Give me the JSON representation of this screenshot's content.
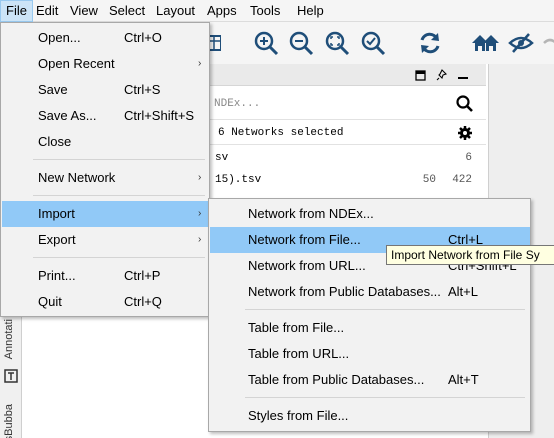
{
  "menubar": {
    "items": [
      "File",
      "Edit",
      "View",
      "Select",
      "Layout",
      "Apps",
      "Tools",
      "Help"
    ]
  },
  "file_menu": {
    "items": [
      {
        "label": "Open...",
        "shortcut": "Ctrl+O"
      },
      {
        "label": "Open Recent",
        "shortcut": ""
      },
      {
        "label": "Save",
        "shortcut": "Ctrl+S"
      },
      {
        "label": "Save As...",
        "shortcut": "Ctrl+Shift+S"
      },
      {
        "label": "Close",
        "shortcut": ""
      },
      {
        "label": "New Network",
        "shortcut": ""
      },
      {
        "label": "Import",
        "shortcut": ""
      },
      {
        "label": "Export",
        "shortcut": ""
      },
      {
        "label": "Print...",
        "shortcut": "Ctrl+P"
      },
      {
        "label": "Quit",
        "shortcut": "Ctrl+Q"
      }
    ],
    "submenu_arrow": "›"
  },
  "import_submenu": {
    "items": [
      {
        "label": "Network from NDEx...",
        "shortcut": ""
      },
      {
        "label": "Network from File...",
        "shortcut": "Ctrl+L"
      },
      {
        "label": "Network from URL...",
        "shortcut": "Ctrl+Shift+L"
      },
      {
        "label": "Network from Public Databases...",
        "shortcut": "Alt+L"
      },
      {
        "label": "Table from File...",
        "shortcut": ""
      },
      {
        "label": "Table from URL...",
        "shortcut": ""
      },
      {
        "label": "Table from Public Databases...",
        "shortcut": "Alt+T"
      },
      {
        "label": "Styles from File...",
        "shortcut": ""
      }
    ]
  },
  "tooltip": "Import Network from File Sy",
  "network_panel": {
    "search_placeholder": "NDEx...",
    "selected_text": "6 Networks selected",
    "rows": [
      {
        "name": "sv",
        "n1": "",
        "n2": "6"
      },
      {
        "name": "15).tsv",
        "n1": "50",
        "n2": "422"
      }
    ]
  },
  "left_tabs": [
    "Annotati",
    "sBubba"
  ],
  "colors": {
    "highlight": "#91c9f7",
    "icon_blue": "#1f4e79",
    "tooltip_bg": "#ffffe1"
  }
}
